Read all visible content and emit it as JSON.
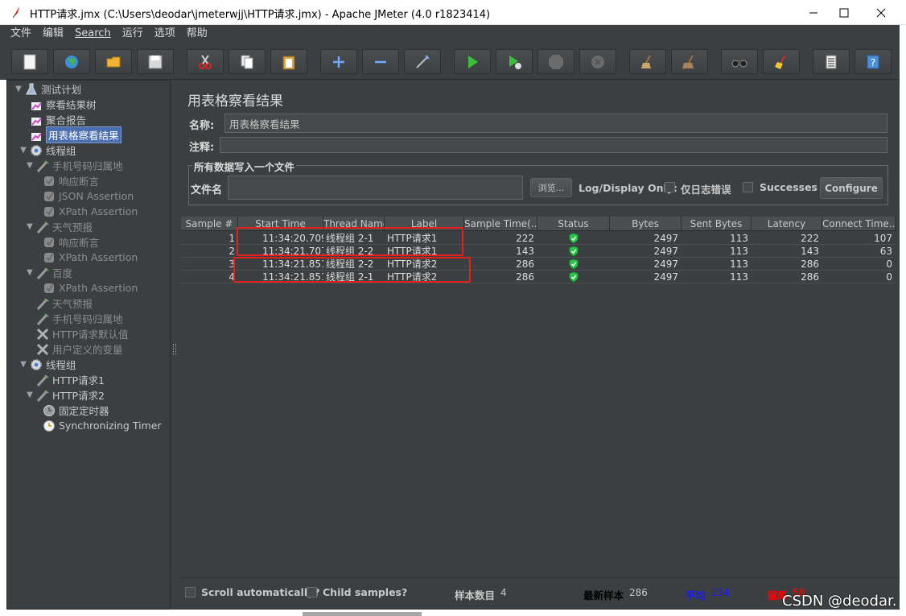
{
  "window": {
    "title": "HTTP请求.jmx (C:\\Users\\deodar\\jmeterwjj\\HTTP请求.jmx) - Apache JMeter (4.0 r1823414)"
  },
  "menu": [
    "文件",
    "编辑",
    "Search",
    "运行",
    "选项",
    "帮助"
  ],
  "toolbar": [
    "new-icon",
    "templates-icon",
    "open-icon",
    "save-icon",
    "cut-icon",
    "copy-icon",
    "paste-icon",
    "expand-icon",
    "collapse-icon",
    "toggle-icon",
    "start-icon",
    "start-no-pause-icon",
    "stop-icon",
    "shutdown-icon",
    "clear-icon",
    "clear-all-icon",
    "search-icon",
    "reset-search-icon",
    "function-helper-icon",
    "help-icon"
  ],
  "tree": [
    {
      "label": "测试计划",
      "level": 0,
      "icon": "flask-icon",
      "toggle": "▼"
    },
    {
      "label": "察看结果树",
      "level": 1,
      "icon": "listener-icon"
    },
    {
      "label": "聚合报告",
      "level": 1,
      "icon": "listener-icon"
    },
    {
      "label": "用表格察看结果",
      "level": 1,
      "icon": "listener-icon",
      "selected": true
    },
    {
      "label": "线程组",
      "level": 1,
      "icon": "gear-icon",
      "toggle": "▼",
      "indent": 0
    },
    {
      "label": "手机号码归属地",
      "level": 2,
      "icon": "sampler-icon",
      "toggle": "▼",
      "disabled": true
    },
    {
      "label": "响应断言",
      "level": 3,
      "icon": "assertion-icon",
      "disabled": true
    },
    {
      "label": "JSON Assertion",
      "level": 3,
      "icon": "assertion-icon",
      "disabled": true
    },
    {
      "label": "XPath Assertion",
      "level": 3,
      "icon": "assertion-icon",
      "disabled": true
    },
    {
      "label": "天气预报",
      "level": 2,
      "icon": "sampler-icon",
      "toggle": "▼",
      "disabled": true
    },
    {
      "label": "响应断言",
      "level": 3,
      "icon": "assertion-icon",
      "disabled": true
    },
    {
      "label": "XPath Assertion",
      "level": 3,
      "icon": "assertion-icon",
      "disabled": true
    },
    {
      "label": "百度",
      "level": 2,
      "icon": "sampler-icon",
      "toggle": "▼",
      "disabled": true
    },
    {
      "label": "XPath Assertion",
      "level": 3,
      "icon": "assertion-icon",
      "disabled": true
    },
    {
      "label": "天气预报",
      "level": 2,
      "icon": "sampler-icon",
      "disabled": true
    },
    {
      "label": "手机号码归属地",
      "level": 2,
      "icon": "sampler-icon",
      "disabled": true
    },
    {
      "label": "HTTP请求默认值",
      "level": 2,
      "icon": "config-icon",
      "disabled": true
    },
    {
      "label": "用户定义的变量",
      "level": 2,
      "icon": "config-icon",
      "disabled": true
    },
    {
      "label": "线程组",
      "level": 1,
      "icon": "gear-icon",
      "toggle": "▼",
      "indent": 0
    },
    {
      "label": "HTTP请求1",
      "level": 2,
      "icon": "sampler-icon"
    },
    {
      "label": "HTTP请求2",
      "level": 2,
      "icon": "sampler-icon",
      "toggle": "▼"
    },
    {
      "label": "固定定时器",
      "level": 3,
      "icon": "timer-icon"
    },
    {
      "label": "Synchronizing Timer",
      "level": 3,
      "icon": "sync-timer-icon"
    }
  ],
  "panel": {
    "title": "用表格察看结果",
    "name_label": "名称:",
    "name_value": "用表格察看结果",
    "comment_label": "注释:",
    "comment_value": "",
    "fileset_legend": "所有数据写入一个文件",
    "filename_label": "文件名",
    "filename_value": "",
    "browse_label": "浏览...",
    "log_display_label": "Log/Display Only:",
    "errors_label": "仅日志错误",
    "successes_label": "Successes",
    "configure_label": "Configure"
  },
  "table": {
    "columns": [
      "Sample #",
      "Start Time",
      "Thread Name",
      "Label",
      "Sample Time(...",
      "Status",
      "Bytes",
      "Sent Bytes",
      "Latency",
      "Connect Time..."
    ],
    "rows": [
      [
        "1",
        "11:34:20.709",
        "线程组 2-1",
        "HTTP请求1",
        "222",
        "ok",
        "2497",
        "113",
        "222",
        "107"
      ],
      [
        "2",
        "11:34:21.707",
        "线程组 2-2",
        "HTTP请求1",
        "143",
        "ok",
        "2497",
        "113",
        "143",
        "63"
      ],
      [
        "3",
        "11:34:21.851",
        "线程组 2-2",
        "HTTP请求2",
        "286",
        "ok",
        "2497",
        "113",
        "286",
        "0"
      ],
      [
        "4",
        "11:34:21.851",
        "线程组 2-1",
        "HTTP请求2",
        "286",
        "ok",
        "2497",
        "113",
        "286",
        "0"
      ]
    ]
  },
  "status": {
    "scroll_label": "Scroll automatically?",
    "child_label": "Child samples?",
    "count_label": "样本数目",
    "count_value": "4",
    "latest_label": "最新样本",
    "latest_value": "286",
    "avg_label": "平均",
    "avg_value": "234",
    "dev_label": "偏离",
    "dev_value": "58"
  },
  "colors": {
    "avg": "#1a1aff",
    "dev": "#ff0000",
    "latest": "#000000"
  },
  "watermark": "CSDN @deodar."
}
